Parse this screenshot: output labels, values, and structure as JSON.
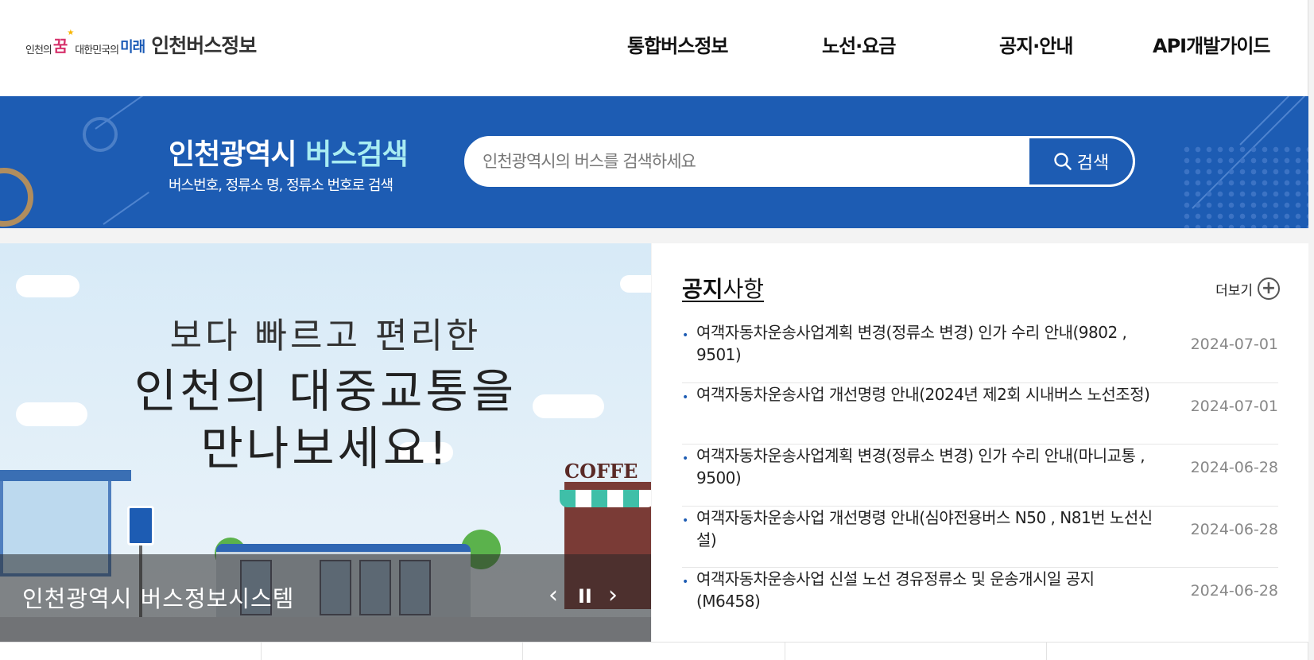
{
  "header": {
    "logo": {
      "slogan_prefix": "인천의",
      "slogan_kkum": "꿈",
      "slogan_mid": "대한민국의",
      "slogan_mirae": "미래",
      "brand": "인천버스정보"
    },
    "nav": [
      "통합버스정보",
      "노선·요금",
      "공지·안내",
      "API개발가이드"
    ]
  },
  "search": {
    "title_part1": "인천광역시",
    "title_part2": "버스검색",
    "subtitle": "버스번호, 정류소 명, 정류소 번호로 검색",
    "placeholder": "인천광역시의 버스를 검색하세요",
    "button_label": "검색",
    "icon": "search-icon",
    "colors": {
      "banner": "#1d5cb3",
      "accent": "#a8ecf2"
    }
  },
  "slideshow": {
    "line1": "보다 빠르고 편리한",
    "line2": "인천의 대중교통을",
    "line3": "만나보세요!",
    "shop_sign": "COFFE",
    "caption": "인천광역시 버스정보시스템",
    "controls": {
      "prev": "‹",
      "pause": "II",
      "next": "›"
    }
  },
  "notice": {
    "title_bold": "공지",
    "title_rest": "사항",
    "more_label": "더보기",
    "more_icon": "plus-circle-icon",
    "items": [
      {
        "title": "여객자동차운송사업계획 변경(정류소 변경) 인가 수리 안내(9802 , 9501)",
        "date": "2024-07-01"
      },
      {
        "title": "여객자동차운송사업 개선명령 안내(2024년 제2회 시내버스 노선조정)",
        "date": "2024-07-01"
      },
      {
        "title": "여객자동차운송사업계획 변경(정류소 변경) 인가 수리 안내(마니교통 , 9500)",
        "date": "2024-06-28"
      },
      {
        "title": "여객자동차운송사업 개선명령 안내(심야전용버스 N50 , N81번 노선신설)",
        "date": "2024-06-28"
      },
      {
        "title": "여객자동차운송사업 신설 노선 경유정류소 및 운송개시일 공지(M6458)",
        "date": "2024-06-28"
      }
    ]
  }
}
